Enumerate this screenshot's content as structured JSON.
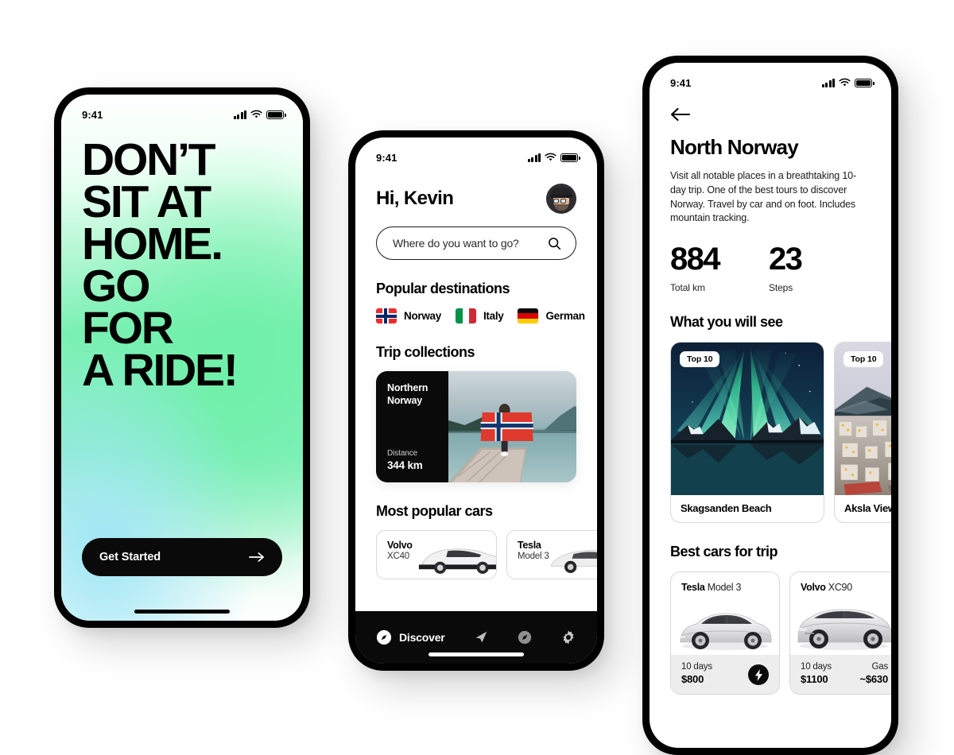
{
  "colors": {
    "black": "#0a0a0a",
    "white": "#ffffff",
    "gradient_green": "#7bf0b4",
    "gradient_cyan": "#9fe6f5",
    "card_border": "#d8d8d8",
    "footer_gray": "#ededed"
  },
  "status_bar": {
    "time": "9:41"
  },
  "onboarding": {
    "headline": "DON’T SIT AT HOME. GO FOR A RIDE!",
    "headline_lines": [
      "DON’T",
      "SIT AT",
      "HOME.",
      "GO",
      "FOR",
      "A RIDE!"
    ],
    "cta_label": "Get Started",
    "cta_icon": "arrow-right-icon"
  },
  "home": {
    "greeting": "Hi, Kevin",
    "avatar_icon": "user-avatar",
    "search": {
      "placeholder": "Where do you want to go?",
      "value": "",
      "icon": "search-icon"
    },
    "popular_destinations": {
      "title": "Popular destinations",
      "items": [
        {
          "name": "Norway",
          "flag": "flag-norway"
        },
        {
          "name": "Italy",
          "flag": "flag-italy"
        },
        {
          "name": "German",
          "flag": "flag-germany"
        }
      ]
    },
    "trip_collections": {
      "title": "Trip collections",
      "card": {
        "name_line1": "Northern",
        "name_line2": "Norway",
        "distance_label": "Distance",
        "distance_value": "344 km",
        "photo": "woman-holding-norwegian-flag-on-dock"
      }
    },
    "popular_cars": {
      "title": "Most popular cars",
      "items": [
        {
          "brand": "Volvo",
          "model": "XC40"
        },
        {
          "brand": "Tesla",
          "model": "Model 3"
        }
      ]
    },
    "tabbar": {
      "items": [
        {
          "label": "Discover",
          "icon": "compass-icon",
          "active": true
        },
        {
          "label": "",
          "icon": "navigation-arrow-icon",
          "active": false
        },
        {
          "label": "",
          "icon": "compass-outline-icon",
          "active": false
        },
        {
          "label": "",
          "icon": "gear-icon",
          "active": false
        }
      ]
    }
  },
  "detail": {
    "back_icon": "arrow-left-icon",
    "title": "North Norway",
    "description": "Visit all notable places in a breathtaking 10-day trip. One of the best tours to discover Norway. Travel by car and on foot. Includes mountain tracking.",
    "stats": [
      {
        "value": "884",
        "label": "Total km"
      },
      {
        "value": "23",
        "label": "Steps"
      }
    ],
    "what_you_will_see": {
      "title": "What you will see",
      "items": [
        {
          "badge": "Top 10",
          "name": "Skagsanden Beach",
          "photo": "aurora-borealis-over-mountains-reflection"
        },
        {
          "badge": "Top 10",
          "name": "Aksla Viewpoint",
          "photo": "alesund-city-from-aksla-viewpoint"
        }
      ]
    },
    "best_cars": {
      "title": "Best cars for trip",
      "items": [
        {
          "brand": "Tesla",
          "model": "Model 3",
          "days": "10 days",
          "price": "$800",
          "fuel_label": "",
          "fuel_price": "",
          "electric": true
        },
        {
          "brand": "Volvo",
          "model": "XC90",
          "days": "10 days",
          "price": "$1100",
          "fuel_label": "Gas",
          "fuel_price": "~$630",
          "electric": false
        }
      ]
    }
  }
}
